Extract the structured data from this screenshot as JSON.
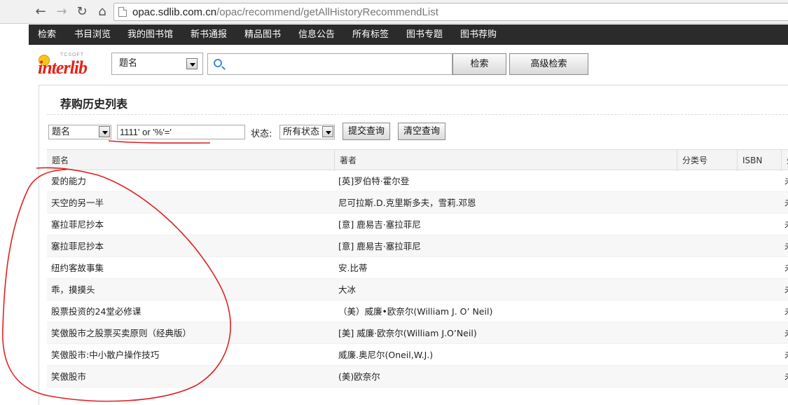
{
  "browser": {
    "url_host": "opac.sdlib.com.cn",
    "url_path": "/opac/recommend/getAllHistoryRecommendList",
    "back_glyph": "←",
    "forward_glyph": "→",
    "reload_glyph": "↻",
    "home_glyph": "⌂"
  },
  "nav": {
    "items": [
      "检索",
      "书目浏览",
      "我的图书馆",
      "新书通报",
      "精品图书",
      "信息公告",
      "所有标签",
      "图书专题",
      "图书荐购"
    ]
  },
  "logo": {
    "tcsoft": "TCSOFT",
    "word": "interlib"
  },
  "search": {
    "field_select": "题名",
    "query": "",
    "search_button": "检索",
    "advanced_button": "高级检索"
  },
  "panel": {
    "title": "荐购历史列表",
    "filter": {
      "field_select": "题名",
      "query": "1111' or '%'='",
      "status_label": "状态:",
      "status_select": "所有状态",
      "submit_button": "提交查询",
      "clear_button": "清空查询"
    }
  },
  "table": {
    "headers": [
      "题名",
      "著者",
      "分类号",
      "ISBN",
      "处"
    ],
    "rows": [
      {
        "title": "爱的能力",
        "author": "[英]罗伯特·霍尔登",
        "status": "未"
      },
      {
        "title": "天空的另一半",
        "author": "尼可拉斯.D.克里斯多夫，雪莉.邓恩",
        "status": "未"
      },
      {
        "title": "塞拉菲尼抄本",
        "author": "[意] 鹿易吉·塞拉菲尼",
        "status": "未"
      },
      {
        "title": "塞拉菲尼抄本",
        "author": "[意] 鹿易吉·塞拉菲尼",
        "status": "未"
      },
      {
        "title": "纽约客故事集",
        "author": "安.比蒂",
        "status": "未"
      },
      {
        "title": "乖，摸摸头",
        "author": "大冰",
        "status": "未"
      },
      {
        "title": "股票投资的24堂必修课",
        "author": "（美）威廉•欧奈尔(William J. O’ Neil)",
        "status": "未"
      },
      {
        "title": "笑傲股市之股票买卖原则（经典版）",
        "author": "[美] 威廉·欧奈尔(William J.O’Neil)",
        "status": "未"
      },
      {
        "title": "笑傲股市:中小散户操作技巧",
        "author": "威廉.奥尼尔(Oneil,W.J.)",
        "status": "未"
      },
      {
        "title": "笑傲股市",
        "author": "(美)欧奈尔",
        "status": "未"
      }
    ]
  },
  "colors": {
    "navbar": "#2b2b2b",
    "logo_red": "#e2231a",
    "annotation_red": "#e02020"
  }
}
